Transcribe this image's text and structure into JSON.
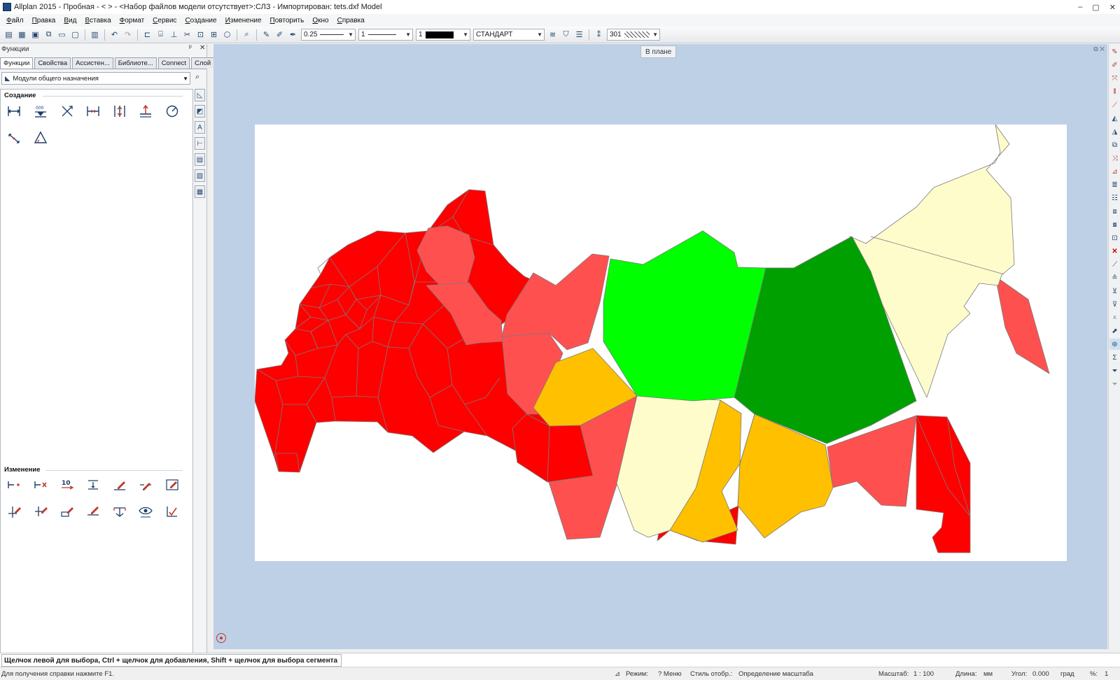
{
  "window": {
    "title": "Allplan 2015 - Пробная - <      > - <Набор файлов модели отсутствует>:СЛЗ - Импортирован: tets.dxf Model",
    "controls": [
      "–",
      "▢",
      "✕"
    ]
  },
  "menu": [
    "Файл",
    "Правка",
    "Вид",
    "Вставка",
    "Формат",
    "Сервис",
    "Создание",
    "Изменение",
    "Повторить",
    "Окно",
    "Справка"
  ],
  "toolbar": {
    "pen_thickness": "0.25",
    "line_type": "1",
    "color_index": "1",
    "style": "СТАНДАРТ",
    "hatch_number": "301"
  },
  "left_panel": {
    "title": "Функции",
    "pin": "ᵖ",
    "close": "✕",
    "tabs": [
      "Функции",
      "Свойства",
      "Ассистен...",
      "Библиоте...",
      "Connect",
      "Слой"
    ],
    "module": "Модули общего назначения",
    "section_create": "Создание",
    "section_modify": "Изменение",
    "modify_label_10": "10"
  },
  "viewport": {
    "tooltip": "В плане",
    "controls": "⧉ ✕",
    "colors": {
      "red": "#ff0000",
      "salmon": "#ff5050",
      "orange": "#ffc000",
      "light_green": "#00ff00",
      "dark_green": "#00a000",
      "cream": "#fffccc"
    }
  },
  "prompt": "Щелчок левой для выбора, Ctrl + щелчок для добавления, Shift + щелчок для выбора сегмента",
  "status": {
    "help": "Для получения справки нажмите F1.",
    "mode": "Режим:",
    "menu": "? Меню",
    "style_label": "Стиль отобр.:",
    "style_value": "Определение масштаба",
    "scale_label": "Масштаб:",
    "scale_value": "1 : 100",
    "length_label": "Длина:",
    "length_value": "мм",
    "angle_label": "Угол:",
    "angle_value": "0.000",
    "angle_unit": "град",
    "percent_label": "%:",
    "percent_value": "1"
  }
}
